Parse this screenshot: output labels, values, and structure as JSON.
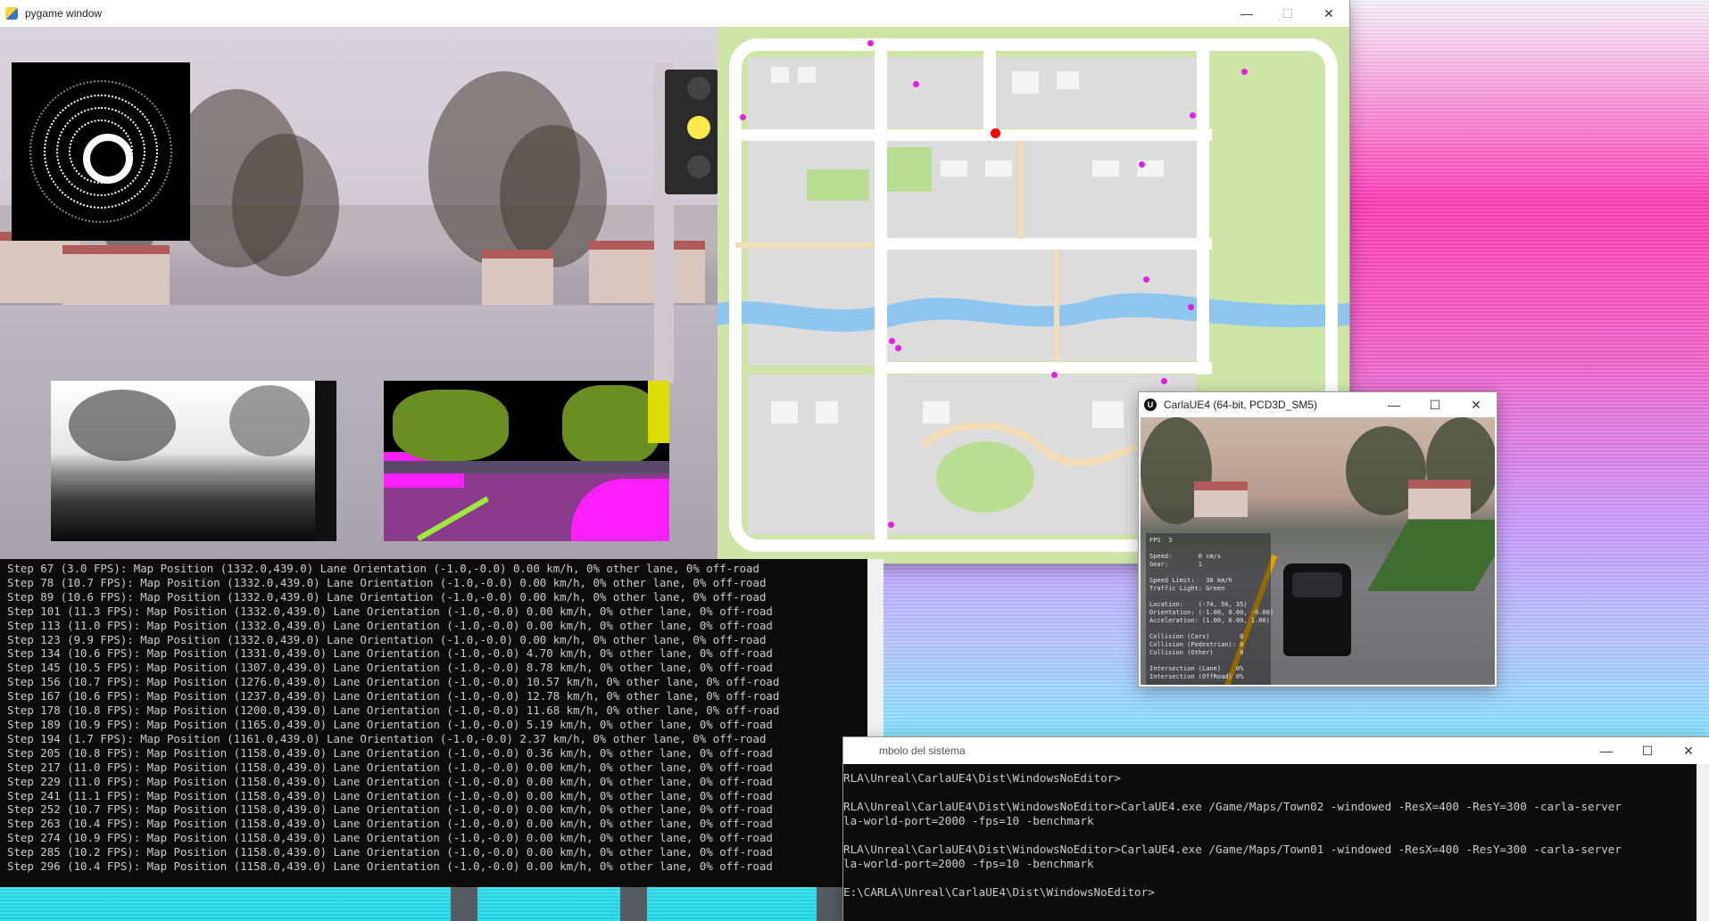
{
  "pygame_window": {
    "title": "pygame window",
    "controls": {
      "minimize": "—",
      "maximize": "☐",
      "close": "✕"
    }
  },
  "map": {
    "vehicle_color": "#ff0000",
    "agent_color": "#e020e0",
    "road_color": "#ffffff",
    "water_color": "#8ec6f0"
  },
  "python_console": {
    "lines": [
      "Step 67 (3.0 FPS): Map Position (1332.0,439.0) Lane Orientation (-1.0,-0.0) 0.00 km/h, 0% other lane, 0% off-road",
      "Step 78 (10.7 FPS): Map Position (1332.0,439.0) Lane Orientation (-1.0,-0.0) 0.00 km/h, 0% other lane, 0% off-road",
      "Step 89 (10.6 FPS): Map Position (1332.0,439.0) Lane Orientation (-1.0,-0.0) 0.00 km/h, 0% other lane, 0% off-road",
      "Step 101 (11.3 FPS): Map Position (1332.0,439.0) Lane Orientation (-1.0,-0.0) 0.00 km/h, 0% other lane, 0% off-road",
      "Step 113 (11.0 FPS): Map Position (1332.0,439.0) Lane Orientation (-1.0,-0.0) 0.00 km/h, 0% other lane, 0% off-road",
      "Step 123 (9.9 FPS): Map Position (1332.0,439.0) Lane Orientation (-1.0,-0.0) 0.00 km/h, 0% other lane, 0% off-road",
      "Step 134 (10.6 FPS): Map Position (1331.0,439.0) Lane Orientation (-1.0,-0.0) 4.70 km/h, 0% other lane, 0% off-road",
      "Step 145 (10.5 FPS): Map Position (1307.0,439.0) Lane Orientation (-1.0,-0.0) 8.78 km/h, 0% other lane, 0% off-road",
      "Step 156 (10.7 FPS): Map Position (1276.0,439.0) Lane Orientation (-1.0,-0.0) 10.57 km/h, 0% other lane, 0% off-road",
      "Step 167 (10.6 FPS): Map Position (1237.0,439.0) Lane Orientation (-1.0,-0.0) 12.78 km/h, 0% other lane, 0% off-road",
      "Step 178 (10.8 FPS): Map Position (1200.0,439.0) Lane Orientation (-1.0,-0.0) 11.68 km/h, 0% other lane, 0% off-road",
      "Step 189 (10.9 FPS): Map Position (1165.0,439.0) Lane Orientation (-1.0,-0.0) 5.19 km/h, 0% other lane, 0% off-road",
      "Step 194 (1.7 FPS): Map Position (1161.0,439.0) Lane Orientation (-1.0,-0.0) 2.37 km/h, 0% other lane, 0% off-road",
      "Step 205 (10.8 FPS): Map Position (1158.0,439.0) Lane Orientation (-1.0,-0.0) 0.36 km/h, 0% other lane, 0% off-road",
      "Step 217 (11.0 FPS): Map Position (1158.0,439.0) Lane Orientation (-1.0,-0.0) 0.00 km/h, 0% other lane, 0% off-road",
      "Step 229 (11.0 FPS): Map Position (1158.0,439.0) Lane Orientation (-1.0,-0.0) 0.00 km/h, 0% other lane, 0% off-road",
      "Step 241 (11.1 FPS): Map Position (1158.0,439.0) Lane Orientation (-1.0,-0.0) 0.00 km/h, 0% other lane, 0% off-road",
      "Step 252 (10.7 FPS): Map Position (1158.0,439.0) Lane Orientation (-1.0,-0.0) 0.00 km/h, 0% other lane, 0% off-road",
      "Step 263 (10.4 FPS): Map Position (1158.0,439.0) Lane Orientation (-1.0,-0.0) 0.00 km/h, 0% other lane, 0% off-road",
      "Step 274 (10.9 FPS): Map Position (1158.0,439.0) Lane Orientation (-1.0,-0.0) 0.00 km/h, 0% other lane, 0% off-road",
      "Step 285 (10.2 FPS): Map Position (1158.0,439.0) Lane Orientation (-1.0,-0.0) 0.00 km/h, 0% other lane, 0% off-road",
      "Step 296 (10.4 FPS): Map Position (1158.0,439.0) Lane Orientation (-1.0,-0.0) 0.00 km/h, 0% other lane, 0% off-road"
    ]
  },
  "carla_window": {
    "title": "CarlaUE4 (64-bit, PCD3D_SM5)",
    "logo": "U",
    "controls": {
      "minimize": "—",
      "maximize": "☐",
      "close": "✕"
    },
    "hud_lines": [
      "FPS  3",
      "",
      "Speed:       0 cm/s",
      "Gear:        1",
      "",
      "Speed Limit:   30 km/h",
      "Traffic Light: Green",
      "",
      "Location:    (-74, 56, 35)",
      "Orientation: (-1.00, 0.00, -0.00)",
      "Acceleration: (1.00, 0.00, 1.00)",
      "",
      "Collision (Cars)        0",
      "Collision (Pedestrian): 0",
      "Collision (Other)       0",
      "",
      "Intersection (Lane)    0%",
      "Intersection (OffRoad) 0%"
    ]
  },
  "cmd_window": {
    "title": "mbolo del sistema",
    "controls": {
      "minimize": "—",
      "maximize": "☐",
      "close": "✕"
    },
    "lines": [
      "RLA\\Unreal\\CarlaUE4\\Dist\\WindowsNoEditor>",
      "",
      "RLA\\Unreal\\CarlaUE4\\Dist\\WindowsNoEditor>CarlaUE4.exe /Game/Maps/Town02 -windowed -ResX=400 -ResY=300 -carla-server",
      "la-world-port=2000 -fps=10 -benchmark",
      "",
      "RLA\\Unreal\\CarlaUE4\\Dist\\WindowsNoEditor>CarlaUE4.exe /Game/Maps/Town01 -windowed -ResX=400 -ResY=300 -carla-server",
      "la-world-port=2000 -fps=10 -benchmark",
      "",
      "E:\\CARLA\\Unreal\\CarlaUE4\\Dist\\WindowsNoEditor>"
    ]
  }
}
